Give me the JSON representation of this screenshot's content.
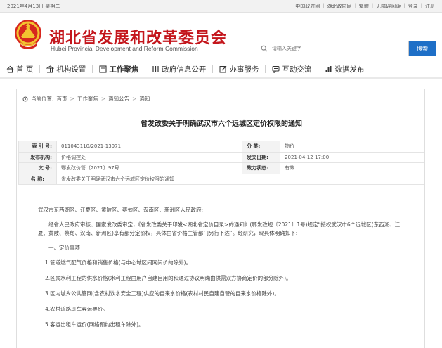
{
  "topbar": {
    "date": "2021年4月13日 星期二",
    "links": [
      "中国政府网",
      "湖北政府网",
      "繁體",
      "无障碍阅读",
      "登录",
      "注册"
    ]
  },
  "header": {
    "title_cn": "湖北省发展和改革委员会",
    "title_en": "Hubei Provincial Development and Reform Commission",
    "search_placeholder": "请输入关键字",
    "search_button": "搜索",
    "brand_red": "#c4161c",
    "accent_blue": "#1e6fc7"
  },
  "nav": {
    "items": [
      {
        "label": "首 页",
        "icon": "home-icon"
      },
      {
        "label": "机构设置",
        "icon": "building-icon"
      },
      {
        "label": "工作聚焦",
        "icon": "focus-icon"
      },
      {
        "label": "政府信息公开",
        "icon": "columns-icon"
      },
      {
        "label": "办事服务",
        "icon": "edit-icon"
      },
      {
        "label": "互动交流",
        "icon": "chat-icon"
      },
      {
        "label": "数据发布",
        "icon": "bar-chart-icon"
      }
    ],
    "active": "工作聚焦"
  },
  "breadcrumb": {
    "prefix": "当前位置:",
    "items": [
      "首页",
      "工作聚焦",
      "通知公告",
      "通知"
    ]
  },
  "article": {
    "title": "省发改委关于明确武汉市六个远城区定价权限的通知",
    "meta": {
      "index_label": "索 引 号:",
      "index_value": "011043110/2021-13971",
      "category_label": "分 类:",
      "category_value": "物价",
      "org_label": "发布机构:",
      "org_value": "价格调控处",
      "date_label": "发文日期:",
      "date_value": "2021-04-12 17:00",
      "doc_label": "文 号:",
      "doc_value": "鄂发改价管〔2021〕97号",
      "status_label": "效力状态:",
      "status_value": "有效",
      "name_label": "名 称:",
      "name_value": "省发改委关于明确武汉市六个远城区定价权限的通知"
    },
    "recipients": "武汉市东西湖区、江夏区、黄陂区、蔡甸区、汉南区、新洲区人民政府:",
    "intro": "经省人民政府审核、国家发改委审定，《省发改委关于印发<湖北省定价目录>的通知》(鄂发改规〔2021〕1号)规定“授权武汉市6个远城区(东西湖、江夏、黄陂、蔡甸、汉南、新洲区)享有部分定价权，具体由省价格主管部门另行下达”。经研究，现具体明确如下:",
    "section": "一、定价事项",
    "list": [
      "1.管道燃气配气价格和销售价格(与中心城区间网间价的除外)。",
      "2.区属水利工程的供水价格(水利工程由用户自建自用的和通过协议明确由供需双方协商定价的部分除外)。",
      "3.区内城乡公共管网(含农村饮水安全工程)供应的自来水价格(农村村民自建自管的自来水价格除外)。",
      "4.农村道路班车客运票价。",
      "5.客运出租车运价(网络预约出租车除外)。"
    ]
  }
}
